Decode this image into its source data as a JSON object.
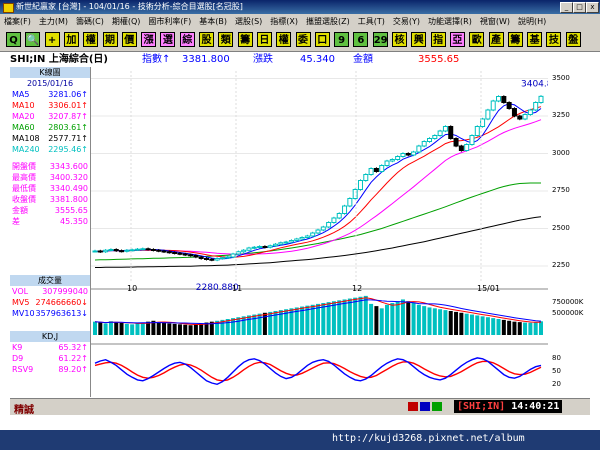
{
  "window": {
    "title": "新世紀贏家 [台灣] - 104/01/16 - 技術分析-綜合目選股[名冠股]",
    "min_label": "_",
    "max_label": "□",
    "close_label": "x"
  },
  "menu": {
    "items": [
      "檔案(F)",
      "主力(M)",
      "籌碼(C)",
      "期權(Q)",
      "國市利率(F)",
      "基本(B)",
      "選股(S)",
      "指標(X)",
      "攜盟選股(Z)",
      "工具(T)",
      "交易(Y)",
      "功能選擇(R)",
      "視窗(W)",
      "說明(H)"
    ]
  },
  "toolbar": {
    "buttons": [
      "Q",
      "🔍",
      "+",
      "加",
      "權",
      "期",
      "價",
      "漲",
      "選",
      "綜",
      "股",
      "類",
      "籌",
      "日",
      "權",
      "委",
      "口",
      "9",
      "6",
      "29",
      "核",
      "興",
      "指",
      "亞",
      "歐",
      "產",
      "籌",
      "基",
      "技",
      "盤"
    ]
  },
  "info": {
    "symbol": "SHI;IN 上海綜合(日)",
    "index_label": "指數↑",
    "index_value": "3381.800",
    "change_label": "漲跌",
    "change_value": "45.340",
    "amount_label": "金額",
    "amount_value": "3555.65"
  },
  "left_panel": {
    "k_header": "K線圖",
    "date": "2015/01/16",
    "ma_rows": [
      {
        "k": "MA5",
        "v": "3281.06↑",
        "color": "#0000ff"
      },
      {
        "k": "MA10",
        "v": "3306.01↑",
        "color": "#ff0000"
      },
      {
        "k": "MA20",
        "v": "3207.87↑",
        "color": "#ff00ff"
      },
      {
        "k": "MA60",
        "v": "2803.61↑",
        "color": "#00a000"
      },
      {
        "k": "MA108",
        "v": "2577.71↑",
        "color": "#000000"
      },
      {
        "k": "MA240",
        "v": "2295.46↑",
        "color": "#00c0c0"
      }
    ],
    "price_rows": [
      {
        "k": "開盤價",
        "v": "3343.600",
        "color": "#ff00ff"
      },
      {
        "k": "最高價",
        "v": "3400.320",
        "color": "#ff00ff"
      },
      {
        "k": "最低價",
        "v": "3340.490",
        "color": "#ff00ff"
      },
      {
        "k": "收盤價",
        "v": "3381.800",
        "color": "#ff00ff"
      },
      {
        "k": "金額",
        "v": "3555.65",
        "color": "#ff00ff"
      },
      {
        "k": "差",
        "v": "45.350",
        "color": "#ff00ff"
      }
    ],
    "vol_header": "成交量",
    "vol_rows": [
      {
        "k": "VOL",
        "v": "307999040",
        "color": "#ff00ff"
      },
      {
        "k": "MV5",
        "v": "274666660↓",
        "color": "#ff0000"
      },
      {
        "k": "MV10",
        "v": "357963613↓",
        "color": "#0000ff"
      }
    ],
    "kd_header": "KD,J",
    "kd_rows": [
      {
        "k": "K9",
        "v": "65.32↑",
        "color": "#ff00ff"
      },
      {
        "k": "D9",
        "v": "61.22↑",
        "color": "#ff00ff"
      },
      {
        "k": "RSV9",
        "v": "89.20↑",
        "color": "#ff00ff"
      }
    ]
  },
  "chart_data": {
    "type": "line",
    "annotations": {
      "high_label": "3404.830",
      "low_label": "2280.880"
    },
    "x_labels": [
      "10",
      "11",
      "12",
      "15/01"
    ],
    "y_ticks_price": [
      "3500",
      "3250",
      "3000",
      "2750",
      "2500",
      "2250"
    ],
    "y_ticks_volume": [
      "750000K",
      "500000K"
    ],
    "y_ticks_kd": [
      "80",
      "50",
      "20"
    ],
    "ylim_price": [
      2150,
      3550
    ],
    "series": [
      {
        "name": "MA5",
        "color": "#0000ff"
      },
      {
        "name": "MA10",
        "color": "#ff0000"
      },
      {
        "name": "MA20",
        "color": "#ff00ff"
      },
      {
        "name": "MA60",
        "color": "#00a000"
      },
      {
        "name": "MA108",
        "color": "#000000"
      },
      {
        "name": "MA240",
        "color": "#00c0c0"
      }
    ],
    "price_close": [
      2350,
      2345,
      2355,
      2360,
      2352,
      2348,
      2355,
      2358,
      2362,
      2365,
      2360,
      2355,
      2350,
      2345,
      2340,
      2335,
      2330,
      2325,
      2320,
      2310,
      2300,
      2295,
      2290,
      2300,
      2305,
      2310,
      2330,
      2345,
      2355,
      2370,
      2375,
      2380,
      2375,
      2385,
      2395,
      2405,
      2410,
      2420,
      2430,
      2440,
      2450,
      2470,
      2490,
      2510,
      2540,
      2570,
      2600,
      2650,
      2700,
      2760,
      2820,
      2860,
      2900,
      2880,
      2920,
      2950,
      2960,
      2980,
      3000,
      2990,
      3010,
      3050,
      3080,
      3100,
      3120,
      3150,
      3180,
      3100,
      3050,
      3020,
      3060,
      3120,
      3180,
      3230,
      3290,
      3350,
      3380,
      3340,
      3300,
      3250,
      3230,
      3260,
      3290,
      3340,
      3381
    ],
    "ma60": [
      2290,
      2291,
      2292,
      2293,
      2294,
      2295,
      2296,
      2297,
      2298,
      2299,
      2300,
      2301,
      2302,
      2303,
      2304,
      2305,
      2306,
      2307,
      2308,
      2310,
      2312,
      2314,
      2316,
      2318,
      2320,
      2322,
      2325,
      2328,
      2331,
      2334,
      2338,
      2342,
      2346,
      2350,
      2355,
      2360,
      2365,
      2370,
      2376,
      2382,
      2388,
      2394,
      2400,
      2407,
      2414,
      2421,
      2428,
      2436,
      2444,
      2452,
      2460,
      2470,
      2480,
      2490,
      2500,
      2512,
      2524,
      2536,
      2548,
      2560,
      2572,
      2584,
      2596,
      2608,
      2620,
      2632,
      2645,
      2658,
      2671,
      2684,
      2697,
      2710,
      2722,
      2734,
      2746,
      2758,
      2770,
      2780,
      2788,
      2795,
      2800,
      2802,
      2803,
      2803,
      2803
    ],
    "ma108": [
      2240,
      2240,
      2241,
      2241,
      2242,
      2242,
      2243,
      2243,
      2244,
      2244,
      2245,
      2245,
      2246,
      2246,
      2247,
      2247,
      2248,
      2248,
      2249,
      2250,
      2251,
      2252,
      2253,
      2254,
      2255,
      2256,
      2258,
      2260,
      2262,
      2264,
      2266,
      2268,
      2270,
      2272,
      2275,
      2278,
      2281,
      2284,
      2287,
      2290,
      2293,
      2296,
      2300,
      2304,
      2308,
      2312,
      2316,
      2320,
      2325,
      2330,
      2335,
      2340,
      2346,
      2352,
      2358,
      2364,
      2370,
      2377,
      2384,
      2391,
      2398,
      2405,
      2412,
      2420,
      2428,
      2436,
      2444,
      2452,
      2460,
      2468,
      2476,
      2484,
      2492,
      2500,
      2508,
      2516,
      2524,
      2532,
      2540,
      2548,
      2556,
      2562,
      2568,
      2574,
      2578
    ],
    "volume": [
      300,
      280,
      260,
      310,
      290,
      270,
      250,
      240,
      260,
      280,
      300,
      320,
      290,
      270,
      260,
      250,
      240,
      230,
      220,
      240,
      260,
      280,
      300,
      320,
      340,
      360,
      380,
      400,
      420,
      440,
      460,
      480,
      500,
      520,
      540,
      560,
      580,
      600,
      620,
      640,
      660,
      680,
      700,
      720,
      740,
      760,
      780,
      800,
      820,
      840,
      860,
      880,
      700,
      650,
      600,
      680,
      720,
      760,
      800,
      760,
      720,
      680,
      650,
      620,
      600,
      580,
      560,
      540,
      520,
      500,
      480,
      460,
      440,
      420,
      400,
      380,
      360,
      340,
      320,
      300,
      290,
      280,
      275,
      280,
      308
    ],
    "kd_k": [
      70,
      75,
      78,
      72,
      65,
      55,
      45,
      38,
      32,
      30,
      35,
      42,
      50,
      58,
      65,
      70,
      72,
      68,
      60,
      50,
      40,
      30,
      25,
      22,
      28,
      38,
      50,
      62,
      72,
      78,
      80,
      76,
      68,
      58,
      48,
      40,
      35,
      38,
      45,
      55,
      65,
      72,
      76,
      78,
      74,
      66,
      56,
      46,
      38,
      32,
      30,
      34,
      42,
      52,
      62,
      70,
      76,
      80,
      78,
      72,
      62,
      52,
      44,
      38,
      34,
      32,
      36,
      44,
      54,
      64,
      72,
      78,
      82,
      80,
      74,
      64,
      54,
      44,
      38,
      36,
      40,
      48,
      56,
      62,
      65
    ],
    "kd_d": [
      65,
      68,
      71,
      72,
      70,
      65,
      58,
      50,
      43,
      38,
      36,
      38,
      42,
      48,
      55,
      61,
      66,
      68,
      66,
      61,
      54,
      46,
      38,
      32,
      30,
      32,
      38,
      46,
      55,
      63,
      69,
      72,
      71,
      67,
      60,
      53,
      47,
      43,
      43,
      47,
      53,
      59,
      65,
      70,
      71,
      69,
      64,
      58,
      51,
      45,
      40,
      37,
      38,
      42,
      49,
      56,
      63,
      69,
      73,
      73,
      70,
      64,
      57,
      51,
      45,
      41,
      39,
      40,
      45,
      51,
      58,
      65,
      71,
      74,
      74,
      71,
      65,
      58,
      51,
      46,
      44,
      45,
      49,
      55,
      61
    ]
  },
  "status": {
    "label": "精誠",
    "code": "[SHI;IN]",
    "time": "14:40:21"
  },
  "watermark": "http://kujd3268.pixnet.net/album"
}
